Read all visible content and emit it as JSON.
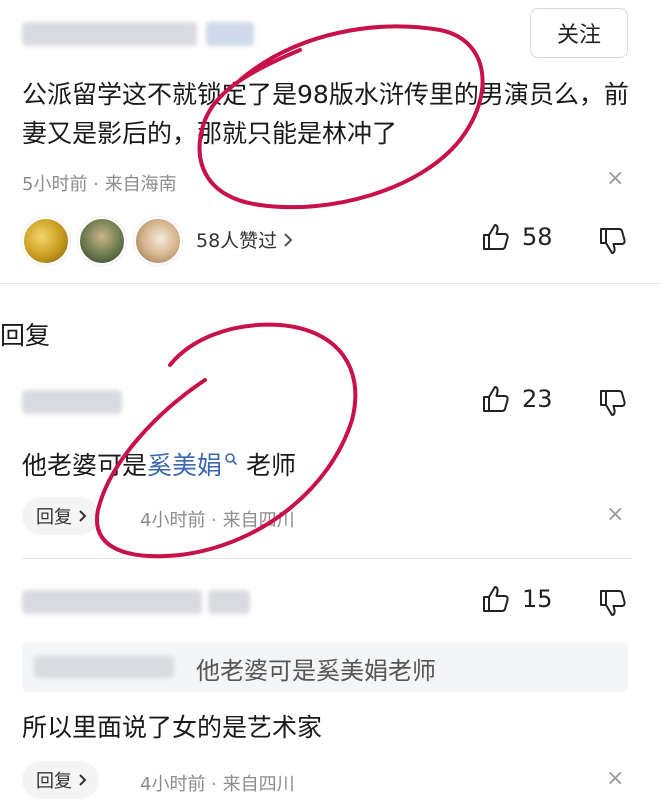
{
  "comment1": {
    "follow_label": "关注",
    "text": "公派留学这不就锁定了是98版水浒传里的男演员么，前妻又是影后的，那就只能是林冲了",
    "meta": "5小时前 · 来自海南",
    "likers_text": "58人赞过",
    "likes": "58",
    "close_glyph": "×"
  },
  "reply_section_title": "回复",
  "reply1": {
    "text_prefix": "他老婆可是",
    "mention": "奚美娟",
    "text_suffix": "老师",
    "reply_label": "回复",
    "meta": "4小时前 · 来自四川",
    "likes": "23",
    "close_glyph": "×"
  },
  "reply2": {
    "quote": "他老婆可是奚美娟老师",
    "text": "所以里面说了女的是艺术家",
    "reply_label": "回复",
    "meta": "4小时前 · 来自四川",
    "likes": "15",
    "close_glyph": "×"
  },
  "colors": {
    "annotation": "#c8104a",
    "mention": "#3b67b0"
  },
  "icons": [
    "thumbs-up-icon",
    "thumbs-down-icon",
    "close-icon",
    "chevron-right-icon",
    "search-icon"
  ]
}
